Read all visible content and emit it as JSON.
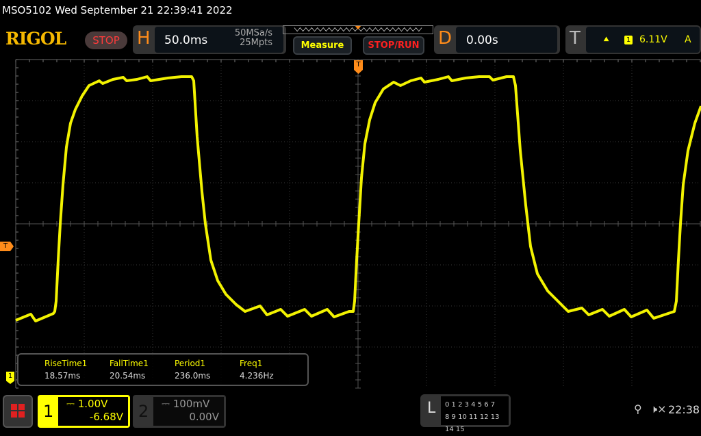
{
  "status_bar": {
    "title": "MSO5102  Wed September 21 22:39:41 2022"
  },
  "header": {
    "logo": "RIGOL",
    "run_state": "STOP",
    "horizontal": {
      "letter": "H",
      "timebase": "50.0ms",
      "sample_rate": "50MSa/s",
      "memory_depth": "25Mpts"
    },
    "measure_button": "Measure",
    "stop_run_button": "STOP/RUN",
    "delay": {
      "letter": "D",
      "value": "0.00s"
    },
    "trigger": {
      "letter": "T",
      "slope_icon": "rising-edge-icon",
      "source": "1",
      "level": "6.11V",
      "mode": "A"
    }
  },
  "screen": {
    "trigger_marker": "T",
    "trigger_position_marker": "T",
    "channel1_marker": "1",
    "trace_color": "#ffff00"
  },
  "measurements": [
    {
      "name": "RiseTime1",
      "value": "18.57ms"
    },
    {
      "name": "FallTime1",
      "value": "20.54ms"
    },
    {
      "name": "Period1",
      "value": "236.0ms"
    },
    {
      "name": "Freq1",
      "value": "4.236Hz"
    }
  ],
  "bottom": {
    "menu_icon": "grid-menu-icon",
    "ch1": {
      "number": "1",
      "scale": "1.00V",
      "offset": "-6.68V",
      "coupling_icon": "dc-coupling-icon"
    },
    "ch2": {
      "number": "2",
      "scale": "100mV",
      "offset": "0.00V",
      "coupling_icon": "dc-coupling-icon"
    },
    "logic": {
      "letter": "L",
      "row1": "0 1 2 3  4 5 6 7",
      "row2": "8 9 10 11 12 13 14 15"
    },
    "usb_icon": "usb-icon",
    "mute_icon": "speaker-muted-icon",
    "clock": "22:38"
  }
}
